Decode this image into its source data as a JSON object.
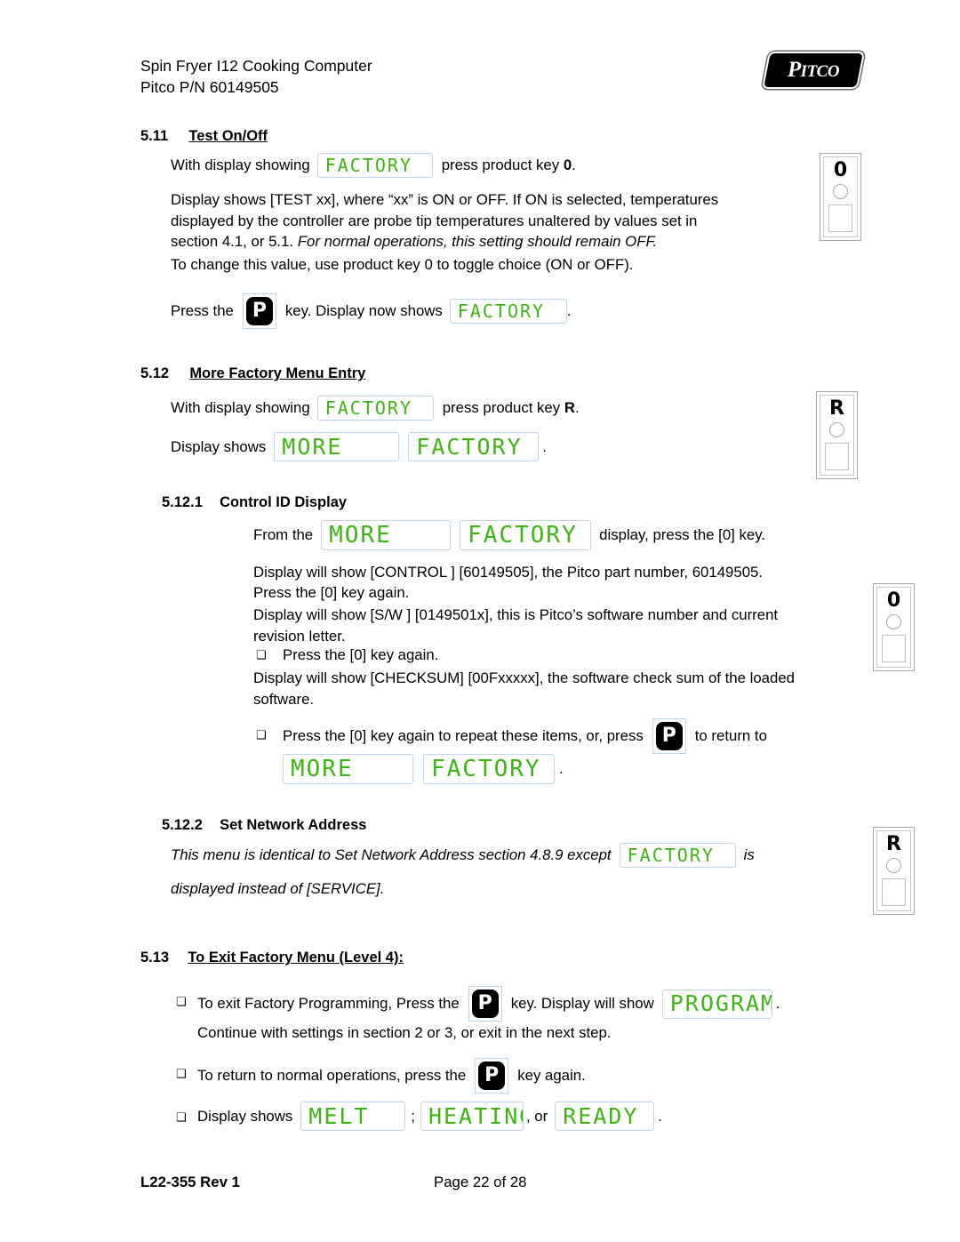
{
  "header": {
    "line1": "Spin Fryer I12 Cooking Computer",
    "line2": "Pitco P/N 60149505",
    "logo_text": "PITCO",
    "logo_text_cap": "P",
    "logo_text_rest": "ITCO"
  },
  "sections": {
    "s511": {
      "number": "5.11",
      "title": "Test On/Off",
      "p1_before": "With display showing",
      "p1_after_pre": "press product key",
      "p1_after_bold": "0",
      "p1_after_post": ".",
      "p1_display": "FACTORY",
      "p2_line1": "Display shows [TEST xx], where “xx” is ON or OFF.  If ON is selected, temperatures",
      "p2_line2": "displayed by the controller are probe tip temperatures unaltered by values set in",
      "p2_line3_normal": "section 4.1, or 5.1.  ",
      "p2_line3_italic": "For normal operations, this setting should remain OFF.",
      "p3": "To change this value, use product key 0 to toggle choice (ON or OFF).",
      "p4_before": "Press the",
      "p4_key": "P",
      "p4_mid": "key. Display now shows",
      "p4_display": "FACTORY",
      "p4_after": "."
    },
    "s512": {
      "number": "5.12",
      "title": "More Factory Menu Entry",
      "p1_before": "With display showing",
      "p1_display": "FACTORY",
      "p1_after_pre": "press product key",
      "p1_after_bold": "R",
      "p1_after_post": ".",
      "p2_before": "Display shows",
      "p2_display_1": "MORE",
      "p2_display_2": "FACTORY",
      "p2_after": "."
    },
    "s5121": {
      "number": "5.12.1",
      "title": "Control ID Display",
      "p1_before": "From the",
      "p1_display_1": "MORE",
      "p1_display_2": "FACTORY",
      "p1_after": "display, press the [0] key.",
      "p2": "Display will show [CONTROL ] [60149505], the Pitco part number, 60149505.",
      "p3": "Press the [0] key again.",
      "p4_line1": "Display will show [S/W          ] [0149501x], this is Pitco’s software number and current",
      "p4_line2": "revision letter.",
      "b1": "Press the [0] key again.",
      "p5_line1": "Display will show [CHECKSUM] [00Fxxxxx], the software check sum of the loaded",
      "p5_line2": "software.",
      "b2_before": "Press the [0] key again to repeat these items, or, press",
      "b2_key": "P",
      "b2_after": "to return to",
      "p6_display_1": "MORE",
      "p6_display_2": "FACTORY",
      "p6_after": "."
    },
    "s5122": {
      "number": "5.12.2",
      "title": "Set Network Address",
      "p1_before": "This menu is identical to Set Network Address section 4.8.9 except",
      "p1_display": "FACTORY",
      "p1_after": "is",
      "p2": "displayed instead of [SERVICE]."
    },
    "s513": {
      "number": "5.13",
      "title": "To Exit Factory Menu (Level 4):",
      "b1_before": "To exit Factory Programming, Press the",
      "b1_key": "P",
      "b1_mid": "key.  Display will show",
      "b1_display": "PROGRAM",
      "b1_after": ".",
      "p1": "Continue with settings in section 2 or 3, or exit in the next step.",
      "b2_before": "To return to normal operations, press the",
      "b2_key": "P",
      "b2_after": "key again.",
      "b3_before": "Display shows",
      "b3_display_1": "MELT",
      "b3_sep1": ";",
      "b3_display_2": "HEATING",
      "b3_sep2": ", or",
      "b3_display_3": "READY",
      "b3_after": "."
    }
  },
  "product_keys": [
    {
      "label": "0"
    },
    {
      "label": "R"
    },
    {
      "label": "0"
    },
    {
      "label": "R"
    }
  ],
  "bullets": {
    "glyph": "❑"
  },
  "footer": {
    "left": "L22-355 Rev 1",
    "center": "Page 22 of 28"
  },
  "colors": {
    "led_green": "#3fb515",
    "led_border": "#c2d4ea",
    "key_black": "#000000"
  }
}
